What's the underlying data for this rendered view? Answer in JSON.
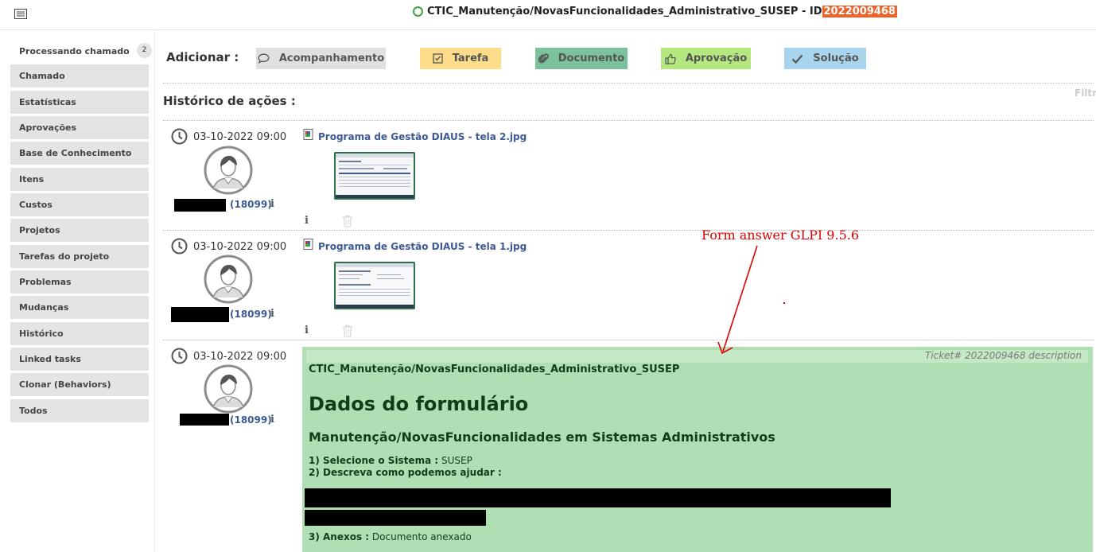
{
  "header": {
    "title": "CTIC_Manutenção/NovasFuncionalidades_Administrativo_SUSEP - ID ",
    "ticket_id": "2022009468"
  },
  "sidebar": {
    "items": [
      {
        "label": "Processando chamado",
        "badge": "2"
      },
      {
        "label": "Chamado"
      },
      {
        "label": "Estatísticas"
      },
      {
        "label": "Aprovações"
      },
      {
        "label": "Base de Conhecimento"
      },
      {
        "label": "Itens"
      },
      {
        "label": "Custos"
      },
      {
        "label": "Projetos"
      },
      {
        "label": "Tarefas do projeto"
      },
      {
        "label": "Problemas"
      },
      {
        "label": "Mudanças"
      },
      {
        "label": "Histórico"
      },
      {
        "label": "Linked tasks"
      },
      {
        "label": "Clonar (Behaviors)"
      },
      {
        "label": "Todos"
      }
    ]
  },
  "actions": {
    "label": "Adicionar :",
    "buttons": [
      {
        "label": "Acompanhamento",
        "icon": "comment-icon",
        "color": "#e0e0e0"
      },
      {
        "label": "Tarefa",
        "icon": "checkbox-icon",
        "color": "#fddc8a"
      },
      {
        "label": "Documento",
        "icon": "paperclip-icon",
        "color": "#7bc19c"
      },
      {
        "label": "Aprovação",
        "icon": "thumbs-up-icon",
        "color": "#b5e77f"
      },
      {
        "label": "Solução",
        "icon": "check-icon",
        "color": "#a9d4ee"
      }
    ]
  },
  "history": {
    "title": "Histórico de ações :",
    "filter": "Filtr",
    "entries": [
      {
        "date": "03-10-2022 09:00",
        "user_id": "(18099)",
        "document": "Programa de Gestão DIAUS - tela 2.jpg"
      },
      {
        "date": "03-10-2022 09:00",
        "user_id": "(18099)",
        "document": "Programa de Gestão DIAUS - tela 1.jpg"
      },
      {
        "date": "03-10-2022 09:00",
        "user_id": "(18099)"
      }
    ]
  },
  "annotation": "Form answer GLPI 9.5.6",
  "description": {
    "header": "Ticket# 2022009468 description",
    "title": "CTIC_Manutenção/NovasFuncionalidades_Administrativo_SUSEP",
    "h1": "Dados do formulário",
    "h2": "Manutenção/NovasFuncionalidades em Sistemas Administrativos",
    "q1_label": "1) Selecione o Sistema :",
    "q1_value": "SUSEP",
    "q2_label": "2) Descreva como podemos ajudar :",
    "q3_label": "3) Anexos :",
    "q3_value": "Documento anexado"
  }
}
